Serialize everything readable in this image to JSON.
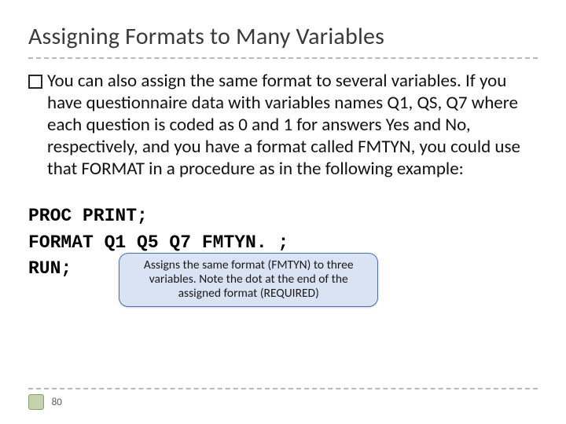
{
  "title": "Assigning Formats to Many Variables",
  "body": "You can also assign the same format to several variables. If you have questionnaire data with variables names Q1, QS, Q7 where each question is coded as 0 and 1 for answers Yes and No, respectively, and you have a format called FMTYN, you could use that FORMAT in a procedure as in the following example:",
  "code": {
    "line1": "PROC PRINT;",
    "line2": "FORMAT Q1 Q5 Q7 FMTYN. ;",
    "line3": "RUN;"
  },
  "callout": "Assigns the same format (FMTYN) to three variables. Note the dot at the end of the assigned format (REQUIRED)",
  "page_number": "80"
}
